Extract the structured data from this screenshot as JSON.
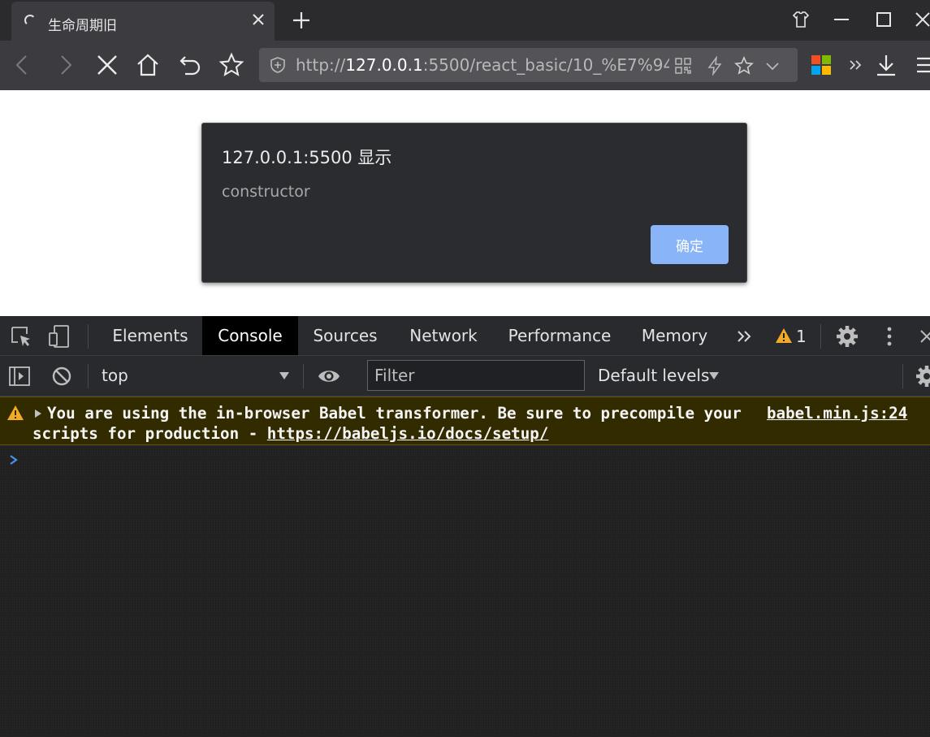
{
  "browser": {
    "tab": {
      "title": "生命周期旧"
    },
    "address": {
      "scheme": "http://",
      "host": "127.0.0.1",
      "rest": ":5500/react_basic/10_%E7%94"
    }
  },
  "alert": {
    "title": "127.0.0.1:5500 显示",
    "message": "constructor",
    "ok_label": "确定"
  },
  "devtools": {
    "tabs": [
      {
        "label": "Elements"
      },
      {
        "label": "Console"
      },
      {
        "label": "Sources"
      },
      {
        "label": "Network"
      },
      {
        "label": "Performance"
      },
      {
        "label": "Memory"
      }
    ],
    "active_tab": "Console",
    "warning_count": "1",
    "console_bar": {
      "context": "top",
      "filter_placeholder": "Filter",
      "levels": "Default levels"
    },
    "messages": [
      {
        "level": "warning",
        "line1": "You are using the in-browser Babel transformer. Be sure to precompile your",
        "line2_prefix": "scripts for production - ",
        "link": "https://babeljs.io/docs/setup/",
        "source": "babel.min.js:24"
      }
    ]
  },
  "colors": {
    "chrome_dark": "#2b2b2e",
    "toolbar": "#3c3c40",
    "dialog_bg": "#2b2c30",
    "accent_blue": "#8ab4f8",
    "warning_bg": "#332b00",
    "warning_icon": "#f2ab26"
  },
  "icons": {
    "tab": [
      "loading-spinner-icon",
      "close-icon",
      "plus-icon"
    ],
    "window": [
      "skin-icon",
      "minimize-icon",
      "maximize-icon",
      "close-icon"
    ],
    "toolbar": [
      "back-icon",
      "forward-icon",
      "stop-icon",
      "home-icon",
      "undo-icon",
      "bookmark-star-icon",
      "shield-icon",
      "qr-code-icon",
      "lightning-icon",
      "star-icon",
      "chevron-down-icon",
      "extension-icon",
      "double-chevron-icon",
      "download-icon",
      "menu-icon"
    ],
    "devtools": [
      "inspect-element-icon",
      "device-toolbar-icon",
      "more-tabs-icon",
      "warning-icon",
      "settings-gear-icon",
      "more-vertical-icon",
      "sidebar-toggle-icon",
      "clear-console-icon",
      "eye-icon"
    ]
  }
}
